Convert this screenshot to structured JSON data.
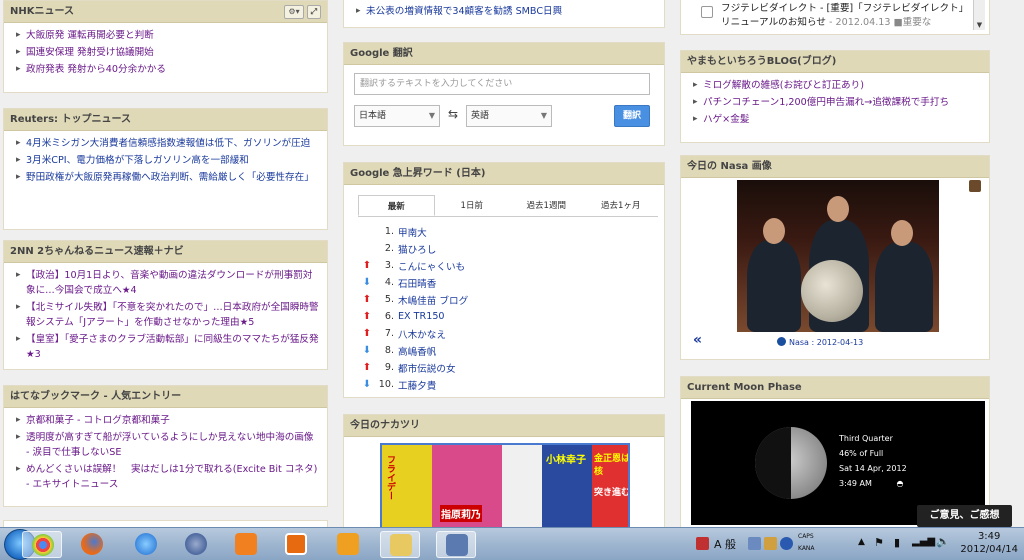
{
  "col1": {
    "nhk": {
      "title": "NHKニュース",
      "items": [
        "大飯原発 運転再開必要と判断",
        "国連安保理 発射受け協議開始",
        "政府発表 発射から40分余かかる"
      ]
    },
    "reuters": {
      "title": "Reuters: トップニュース",
      "items": [
        "4月米ミシガン大消費者信頼感指数速報値は低下、ガソリンが圧迫",
        "3月米CPI、電力価格が下落しガソリン高を一部緩和",
        "野田政権が大飯原発再稼働へ政治判断、需給厳しく「必要性存在」"
      ]
    },
    "twonn": {
      "title": "2NN 2ちゃんねるニュース速報＋ナビ",
      "items": [
        "【政治】10月1日より、音楽や動画の違法ダウンロードが刑事罰対象に…今国会で成立へ★4",
        "【北ミサイル失敗】「不意を突かれたので」…日本政府が全国瞬時警報システム「Jアラート」を作動させなかった理由★5",
        "【皇室】「愛子さまのクラブ活動転部」に同級生のママたちが猛反発★3"
      ]
    },
    "hatena": {
      "title": "はてなブックマーク - 人気エントリー",
      "items": [
        "京都和菓子 - コトログ京都和菓子",
        "透明度が高すぎて船が浮いているようにしか見えない地中海の画像 - 涙目で仕事しないSE",
        "めんどくさいは誤解！　実はだしは1分で取れる(Excite Bit コネタ) - エキサイトニュース"
      ]
    }
  },
  "col2": {
    "top_item": "未公表の増資情報で34顧客を勧誘 SMBC日興",
    "translate": {
      "title": "Google 翻訳",
      "placeholder": "翻訳するテキストを入力してください",
      "from": "日本語",
      "to": "英語",
      "button": "翻訳"
    },
    "trends": {
      "title": "Google 急上昇ワード (日本)",
      "tabs": [
        "最新",
        "1日前",
        "過去1週間",
        "過去1ヶ月"
      ],
      "items": [
        {
          "n": "1.",
          "name": "甲南大",
          "dir": ""
        },
        {
          "n": "2.",
          "name": "猫ひろし",
          "dir": ""
        },
        {
          "n": "3.",
          "name": "こんにゃくいも",
          "dir": "up"
        },
        {
          "n": "4.",
          "name": "石田晴香",
          "dir": "down"
        },
        {
          "n": "5.",
          "name": "木嶋佳苗 ブログ",
          "dir": "up"
        },
        {
          "n": "6.",
          "name": "EX TR150",
          "dir": "up"
        },
        {
          "n": "7.",
          "name": "八木かなえ",
          "dir": "up"
        },
        {
          "n": "8.",
          "name": "高嶋香帆",
          "dir": "down"
        },
        {
          "n": "9.",
          "name": "都市伝説の女",
          "dir": "up"
        },
        {
          "n": "10.",
          "name": "工藤夕貴",
          "dir": "down"
        }
      ]
    },
    "nakatsuri": {
      "title": "今日のナカツリ",
      "mag_labels": [
        "フライデー",
        "指原莉乃",
        "小林幸子",
        "金正恩は核",
        "突き進む"
      ]
    }
  },
  "col3": {
    "twitter": {
      "text": "フジテレビダイレクト - [重要]「フジテレビダイレクト」リニューアルのお知らせ",
      "date": "- 2012.04.13",
      "tail": "■重要な"
    },
    "blog": {
      "title": "やまもといちろうBLOG(ブログ)",
      "items": [
        "ミログ解散の雑感(お詫びと訂正あり)",
        "パチンコチェーン1,200億円申告漏れ→追徴課税で手打ち",
        "ハゲ×金髪"
      ]
    },
    "nasa": {
      "title": "今日の Nasa 画像",
      "caption": "Nasa : 2012-04-13",
      "prev": "«"
    },
    "moon": {
      "title": "Current Moon Phase",
      "phase": "Third Quarter",
      "full": "46% of Full",
      "date": "Sat 14 Apr, 2012",
      "time": "3:49 AM"
    }
  },
  "popup": "ご意見、ご感想",
  "taskbar": {
    "clock_time": "3:49",
    "clock_date": "2012/04/14",
    "tray_text": "A 般",
    "caps": "CAPS",
    "kana": "KANA"
  }
}
